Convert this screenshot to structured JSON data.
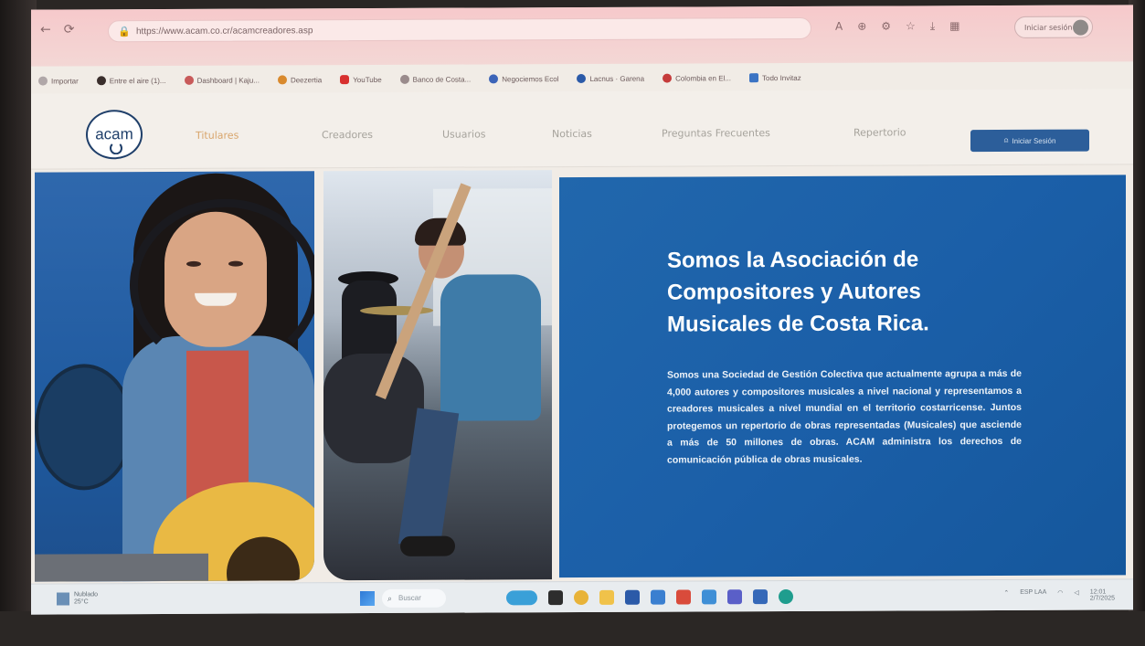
{
  "browser": {
    "url": "https://www.acam.co.cr/acamcreadores.asp",
    "profile_label": "Iniciar sesión",
    "bookmarks": [
      {
        "label": "Importar",
        "color": "#b0a7a8"
      },
      {
        "label": "Entre el aire (1)...",
        "color": "#3a2e2c"
      },
      {
        "label": "Dashboard | Kaju...",
        "color": "#c85a5a"
      },
      {
        "label": "Deezertia",
        "color": "#d98a2e"
      },
      {
        "label": "YouTube",
        "color": "#d8302f"
      },
      {
        "label": "Banco de Costa...",
        "color": "#9a8b8c"
      },
      {
        "label": "Negociemos Ecol",
        "color": "#3c64b8"
      },
      {
        "label": "Lacnus · Garena",
        "color": "#2b5aa8"
      },
      {
        "label": "Colombia en El...",
        "color": "#c53b3b"
      },
      {
        "label": "Todo Invitaz",
        "color": "#3c74c4"
      }
    ]
  },
  "site": {
    "logo_text": "acam",
    "menu": [
      "Titulares",
      "Creadores",
      "Usuarios",
      "Noticias",
      "Preguntas Frecuentes",
      "Repertorio"
    ],
    "login_button": "Iniciar Sesión",
    "hero_title": "Somos la Asociación de Compositores y Autores Musicales de Costa Rica.",
    "hero_text": "Somos una Sociedad de Gestión Colectiva que actualmente agrupa a más de 4,000 autores y compositores musicales a nivel nacional y representamos a creadores musicales a nivel mundial en el territorio costarricense. Juntos protegemos un repertorio de obras representadas (Musicales) que asciende a más de 50 millones de obras. ACAM administra los derechos de comunicación pública de obras musicales."
  },
  "taskbar": {
    "weather_temp": "Nublado",
    "weather_sub": "25°C",
    "search_placeholder": "Buscar",
    "tray_lang": "ESP LAA",
    "tray_time": "12:01",
    "tray_date": "2/7/2025"
  },
  "colors": {
    "hero_blue": "#1b5fa8",
    "login_button": "#2c5e9a",
    "active_menu": "#d8a56b"
  }
}
